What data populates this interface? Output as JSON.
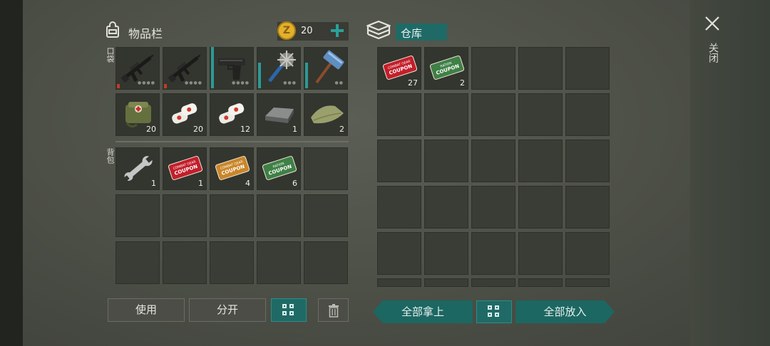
{
  "inventory": {
    "title": "物品栏",
    "coins": "20",
    "pocket_label": "口袋",
    "backpack_label": "背包",
    "pocket_items": [
      {
        "icon": "assault-rifle-icon",
        "count": "",
        "durability_dots": "●●●●"
      },
      {
        "icon": "assault-rifle-icon",
        "count": "",
        "durability_dots": "●●●●"
      },
      {
        "icon": "pistol-icon",
        "count": "",
        "durability_dots": "●●●●"
      },
      {
        "icon": "spiked-club-icon",
        "count": "",
        "durability_dots": "●●●"
      },
      {
        "icon": "sledgehammer-icon",
        "count": "",
        "durability_dots": "●●"
      },
      {
        "icon": "medical-bag-icon",
        "count": "20"
      },
      {
        "icon": "bandage-icon",
        "count": "20"
      },
      {
        "icon": "bandage-icon",
        "count": "12"
      },
      {
        "icon": "metal-ingot-icon",
        "count": "1"
      },
      {
        "icon": "cloth-icon",
        "count": "2"
      }
    ],
    "backpack_items": [
      {
        "icon": "wrench-icon",
        "count": "1"
      },
      {
        "icon": "red-coupon-icon",
        "count": "1"
      },
      {
        "icon": "orange-coupon-icon",
        "count": "4"
      },
      {
        "icon": "green-coupon-icon",
        "count": "6"
      }
    ],
    "buttons": {
      "use": "使用",
      "split": "分开"
    }
  },
  "storage": {
    "title": "仓库",
    "items": [
      {
        "icon": "red-coupon-icon",
        "count": "27"
      },
      {
        "icon": "green-coupon-icon",
        "count": "2"
      }
    ],
    "buttons": {
      "take_all": "全部拿上",
      "put_all": "全部放入"
    }
  },
  "close_label": "关闭",
  "coupon_text": {
    "red_top": "COMBAT GEAR",
    "red_bottom": "COUPON",
    "orange_top": "COMBAT GEAR",
    "orange_bottom": "COUPON",
    "green_top": "RATION",
    "green_bottom": "COUPON"
  },
  "colors": {
    "accent": "#1f6a66",
    "bar_red": "#c23a26",
    "bar_teal": "#2b9a95"
  }
}
